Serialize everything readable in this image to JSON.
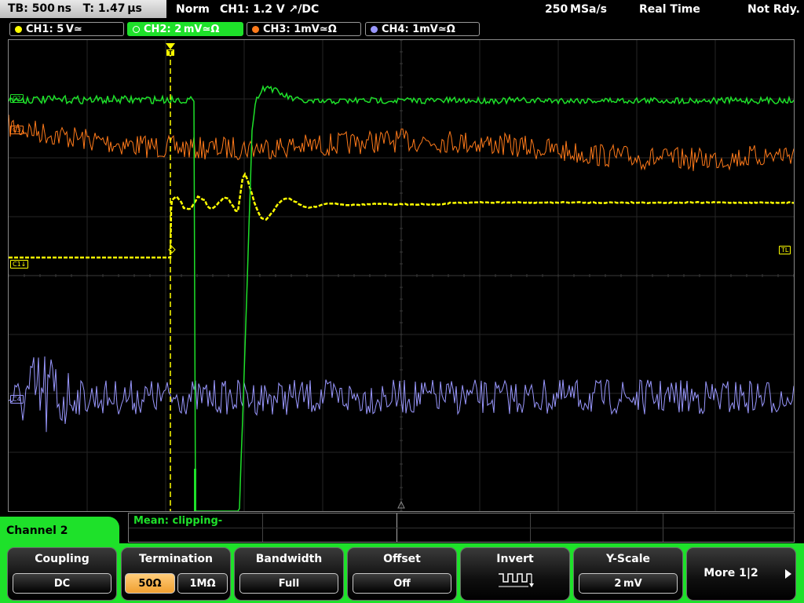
{
  "topbar": {
    "timebase": "TB: 500 ns",
    "trigger_time": "T: 1.47 µs",
    "mode": "Norm",
    "trigger": "CH1: 1.2 V ↗/DC",
    "sample_rate": "250 MSa/s",
    "acq_mode": "Real Time",
    "status": "Not Rdy."
  },
  "channels": [
    {
      "label": "CH1: 5 V≃",
      "color": "#ffff00"
    },
    {
      "label": "CH2: 2 mV≃Ω",
      "color": "#1ee12a",
      "active": true
    },
    {
      "label": "CH3: 1mV≃Ω",
      "color": "#ff7a1a"
    },
    {
      "label": "CH4: 1mV≃Ω",
      "color": "#9a98ff"
    }
  ],
  "screen": {
    "markers": {
      "c2": "C2",
      "c3": "C3",
      "c1": "C1↓",
      "c4": "C4",
      "tl": "TL"
    },
    "trigger_marker": "T"
  },
  "measurement": {
    "text": "Mean: clipping-"
  },
  "panel": {
    "title": "Channel 2",
    "coupling": {
      "label": "Coupling",
      "value": "DC"
    },
    "termination": {
      "label": "Termination",
      "opt1": "50Ω",
      "opt2": "1MΩ",
      "selected": "50Ω"
    },
    "bandwidth": {
      "label": "Bandwidth",
      "value": "Full"
    },
    "offset": {
      "label": "Offset",
      "value": "Off"
    },
    "invert": {
      "label": "Invert",
      "icon": "inverted-square-wave-icon"
    },
    "yscale": {
      "label": "Y-Scale",
      "value": "2 mV"
    },
    "more": {
      "label": "More 1|2"
    }
  },
  "colors": {
    "ch1": "#ffff00",
    "ch2": "#1ee12a",
    "ch3": "#ff7a1a",
    "ch4": "#9a98ff",
    "panel": "#1ee12a"
  }
}
